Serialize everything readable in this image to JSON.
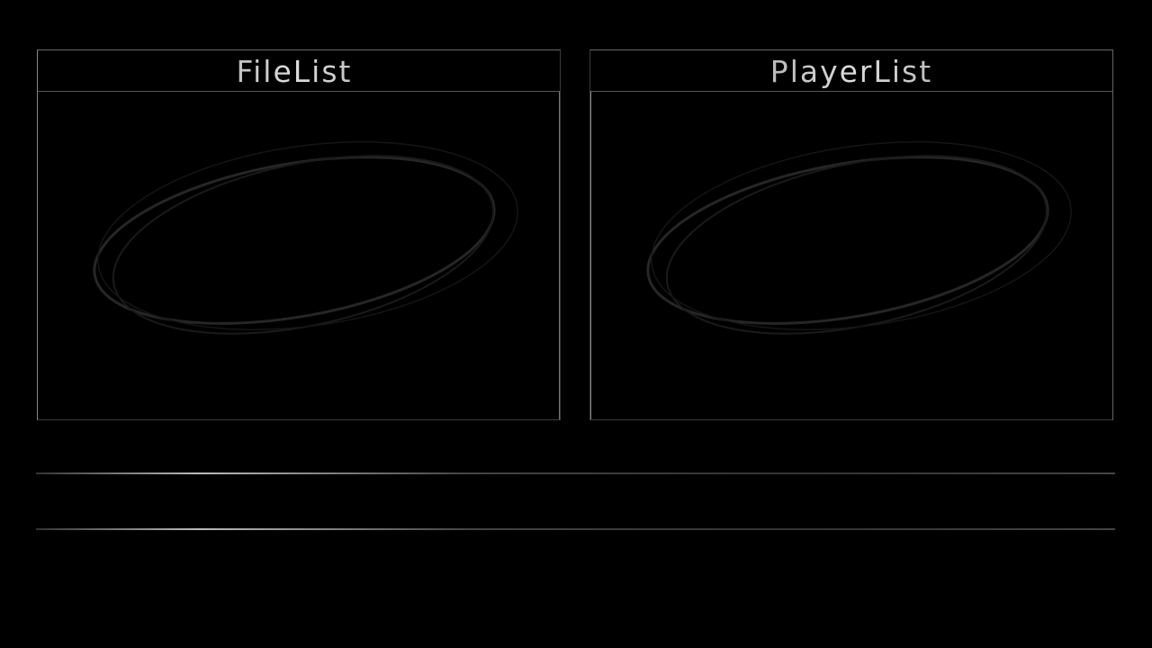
{
  "panels": {
    "file_list": {
      "title": "FileList"
    },
    "player_list": {
      "title": "PlayerList"
    }
  }
}
